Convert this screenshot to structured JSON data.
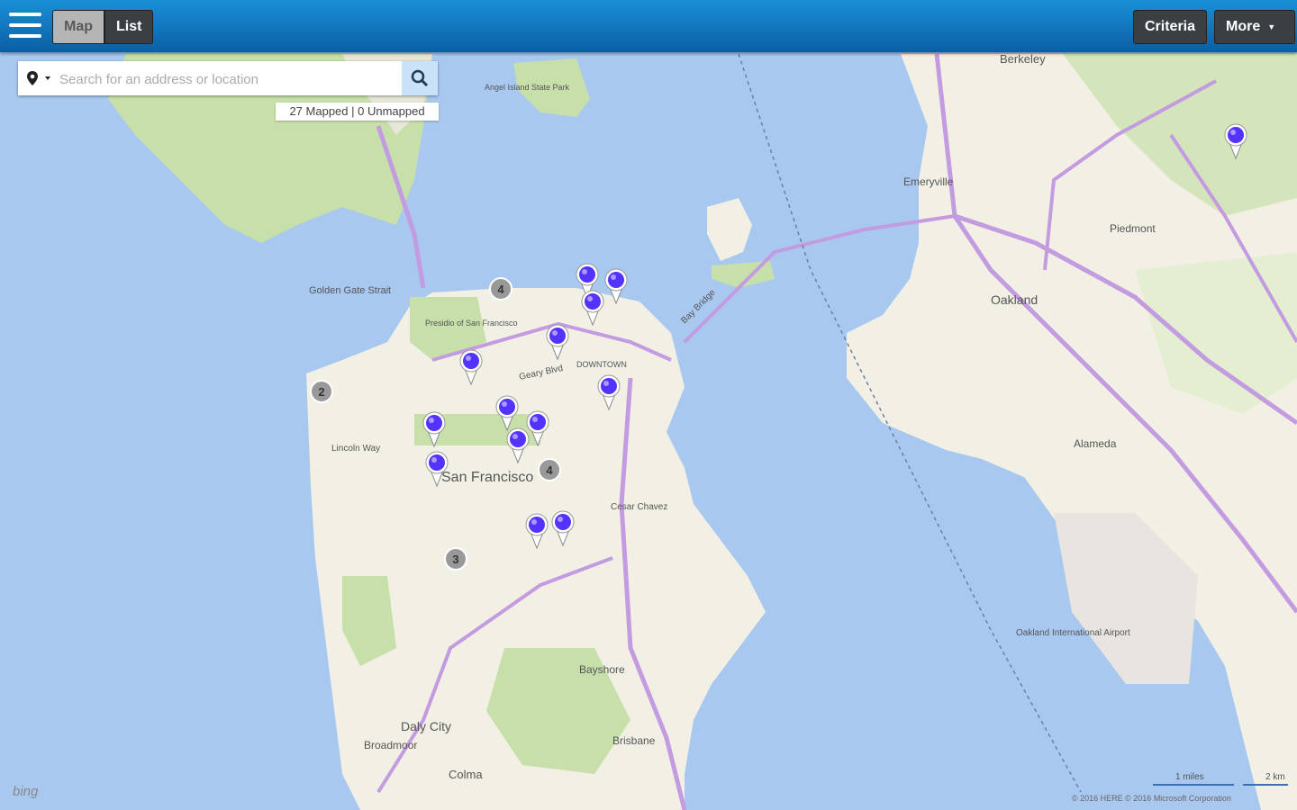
{
  "toolbar": {
    "tabs": [
      {
        "label": "Map",
        "active": true
      },
      {
        "label": "List",
        "active": false
      }
    ],
    "criteria_label": "Criteria",
    "more_label": "More"
  },
  "search": {
    "placeholder": "Search for an address or location",
    "mapped_status": "27 Mapped | 0 Unmapped"
  },
  "map": {
    "provider": "bing",
    "places": {
      "berkeley": "Berkeley",
      "emeryville": "Emeryville",
      "piedmont": "Piedmont",
      "oakland": "Oakland",
      "alameda": "Alameda",
      "san_francisco": "San Francisco",
      "daly_city": "Daly City",
      "brisbane": "Brisbane",
      "bayshore": "Bayshore",
      "colma": "Colma",
      "broadmoor": "Broadmoor",
      "golden_gate_strait": "Golden Gate Strait",
      "angel_island": "Angel Island State Park",
      "downtown": "DOWNTOWN",
      "bay_bridge": "Bay Bridge",
      "airport": "Oakland International Airport",
      "geary": "Geary Blvd",
      "lincoln": "Lincoln Way",
      "castro": "Cesar Chavez",
      "presidio": "Presidio of San Francisco"
    },
    "clusters": [
      "4",
      "2",
      "4",
      "3"
    ],
    "scale": {
      "miles": "1 miles",
      "km": "2 km"
    },
    "copyright": "© 2016 HERE   © 2016 Microsoft Corporation"
  },
  "colors": {
    "toolbar": "#1a8fd6",
    "marker": "#5533ff",
    "water": "#a8c8f0",
    "land": "#f2efe4",
    "park": "#c7dfa9",
    "highway": "#c39be0"
  }
}
